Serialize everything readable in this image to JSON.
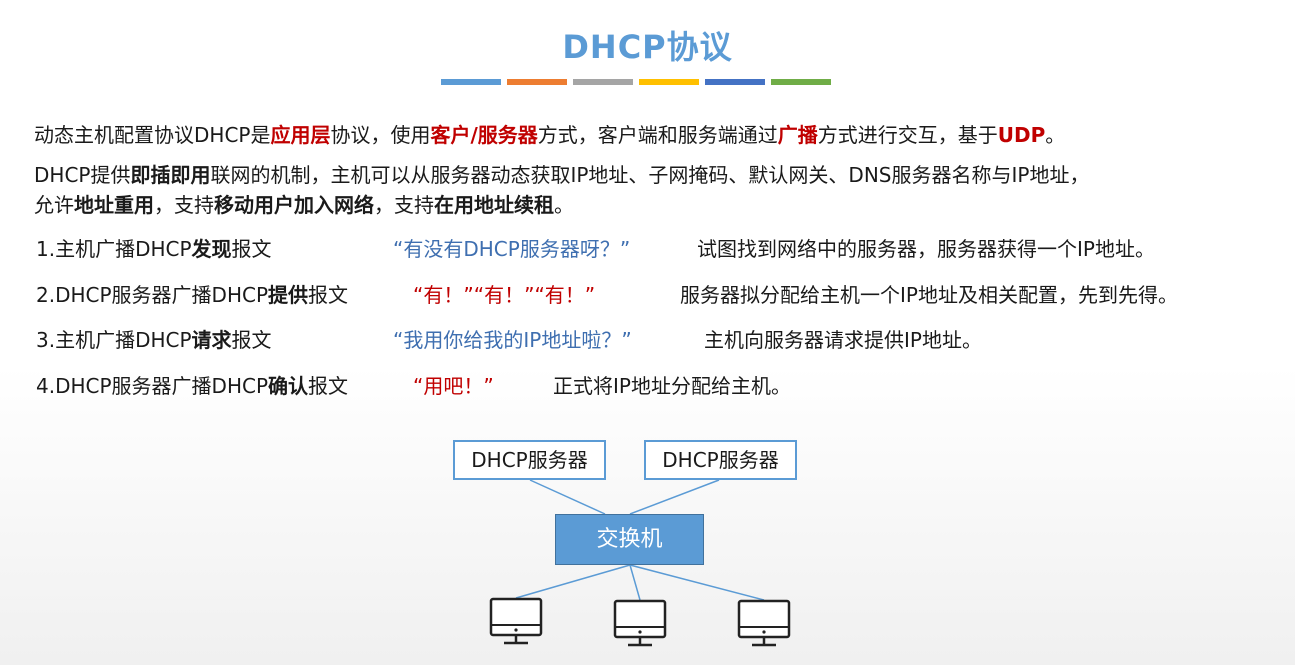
{
  "title": "DHCP协议",
  "color_bar": [
    "#5b9bd5",
    "#ed7d31",
    "#a5a5a5",
    "#ffc000",
    "#4472c4",
    "#70ad47"
  ],
  "intro": {
    "p1": [
      "动态主机配置协议DHCP是",
      "应用层",
      "协议，使用",
      "客户/服务器",
      "方式，客户端和服务端通过",
      "广播",
      "方式进行交互，基于",
      "UDP",
      "。"
    ],
    "p2": [
      "DHCP提供",
      "即插即用",
      "联网的机制，主机可以从服务器动态获取IP地址、子网掩码、默认网关、DNS服务器名称与IP地址，"
    ],
    "p3": [
      "允许",
      "地址重用",
      "，支持",
      "移动用户加入网络",
      "，支持",
      "在用地址续租",
      "。"
    ]
  },
  "steps": [
    {
      "prefix": "1.主机广播DHCP",
      "bold": "发现",
      "suffix": "报文",
      "quote": "“有没有DHCP服务器呀？”",
      "desc": "试图找到网络中的服务器，服务器获得一个IP地址。"
    },
    {
      "prefix": "2.DHCP服务器广播DHCP",
      "bold": "提供",
      "suffix": "报文",
      "quote": "“有！”“有！”“有！”",
      "desc": "服务器拟分配给主机一个IP地址及相关配置，先到先得。"
    },
    {
      "prefix": "3.主机广播DHCP",
      "bold": "请求",
      "suffix": "报文",
      "quote": "“我用你给我的IP地址啦？”",
      "desc": "主机向服务器请求提供IP地址。"
    },
    {
      "prefix": "4.DHCP服务器广播DHCP",
      "bold": "确认",
      "suffix": "报文",
      "quote": "“用吧！”",
      "desc": "正式将IP地址分配给主机。"
    }
  ],
  "diagram": {
    "servers": [
      "DHCP服务器",
      "DHCP服务器"
    ],
    "switch": "交换机",
    "hosts": [
      "monitor-icon",
      "monitor-icon",
      "monitor-icon"
    ]
  }
}
